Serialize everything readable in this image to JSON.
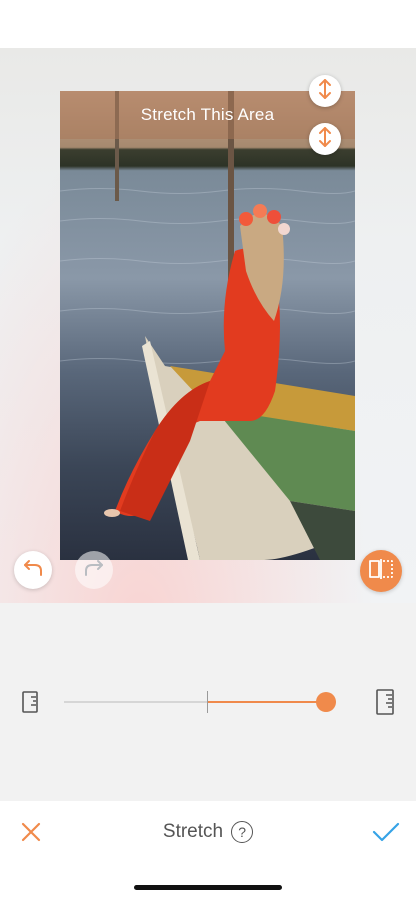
{
  "canvas": {
    "stretch_label": "Stretch This Area",
    "icons": {
      "handle_top": "vertical-resize-icon",
      "handle_bottom": "vertical-resize-icon",
      "undo": "undo-arrow-icon",
      "redo": "redo-arrow-icon",
      "compare": "compare-split-icon"
    }
  },
  "slider": {
    "value": 1.0,
    "min_icon": "ruler-small-icon",
    "max_icon": "ruler-large-icon"
  },
  "toolbar": {
    "title": "Stretch",
    "help_symbol": "?",
    "cancel_icon": "close-x-icon",
    "confirm_icon": "checkmark-icon"
  },
  "colors": {
    "accent": "#f08a4b",
    "confirm": "#36a3e6"
  }
}
